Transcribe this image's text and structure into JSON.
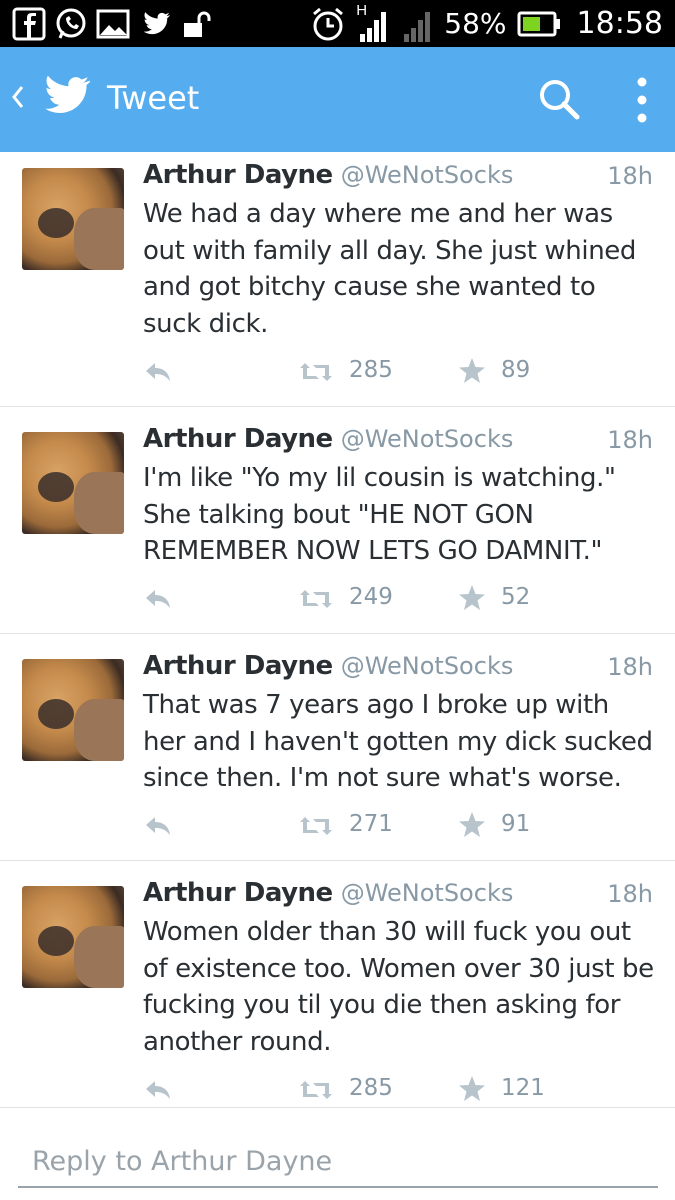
{
  "status_bar": {
    "icons": [
      "facebook-icon",
      "whatsapp-icon",
      "gallery-icon",
      "twitter-icon",
      "unlock-icon",
      "alarm-icon",
      "signal-icon",
      "signal-icon"
    ],
    "network_letter": "H",
    "battery": "58%",
    "time": "18:58"
  },
  "app_bar": {
    "title": "Tweet",
    "color": "#55acee"
  },
  "tweets": [
    {
      "name": "Arthur Dayne",
      "handle": "@WeNotSocks",
      "time": "18h",
      "text": "We had a day where me and her was out with family all day. She just whined and got bitchy cause she wanted to suck dick.",
      "retweets": "285",
      "favorites": "89"
    },
    {
      "name": "Arthur Dayne",
      "handle": "@WeNotSocks",
      "time": "18h",
      "text": "I'm like \"Yo my lil cousin is watching.\" She talking bout \"HE NOT GON REMEMBER NOW LETS GO DAMNIT.\"",
      "retweets": "249",
      "favorites": "52"
    },
    {
      "name": "Arthur Dayne",
      "handle": "@WeNotSocks",
      "time": "18h",
      "text": "That was 7 years ago I broke up with her and I haven't gotten my dick sucked since then. I'm not sure what's worse.",
      "retweets": "271",
      "favorites": "91"
    },
    {
      "name": "Arthur Dayne",
      "handle": "@WeNotSocks",
      "time": "18h",
      "text": "Women older than 30 will fuck you out of existence too. Women over 30 just be fucking you til you die then asking for another round.",
      "retweets": "285",
      "favorites": "121"
    }
  ],
  "reply": {
    "placeholder": "Reply to Arthur Dayne"
  }
}
